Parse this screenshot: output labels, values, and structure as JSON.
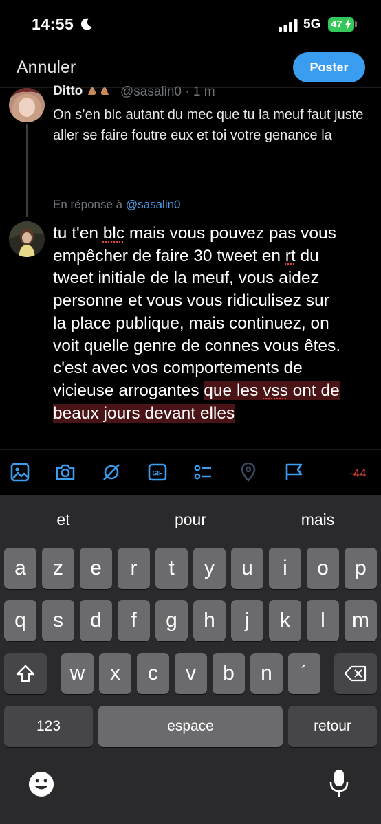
{
  "status_bar": {
    "time": "14:55",
    "network": "5G",
    "battery": "47"
  },
  "header": {
    "cancel_label": "Annuler",
    "post_label": "Poster"
  },
  "original_tweet": {
    "author": "Ditto",
    "handle": "@sasalin0 · 1 m",
    "text": "On s’en blc autant du mec que tu la meuf faut juste aller se faire foutre eux et toi votre genance la"
  },
  "reply": {
    "reply_to_prefix": "En réponse à",
    "reply_to_handle": "@sasalin0",
    "lines": {
      "l1a": "tu t'en ",
      "l1b": "blc",
      "l1c": " mais vous pouvez pas vous",
      "l2a": "empêcher de faire 30 tweet en ",
      "l2b": "rt",
      "l2c": " du",
      "l3": "tweet initiale de la meuf, vous aidez",
      "l4": "personne et vous vous ridiculisez sur",
      "l5": "la place publique, mais continuez, on",
      "l6": "voit quelle genre de connes vous êtes.",
      "l7": "c'est avec vos comportements de",
      "l8a": "vicieuse arrogantes ",
      "l8b": "que les ",
      "l8c": "vss",
      "l8d": " ont de",
      "l9": "beaux jours devant elles"
    }
  },
  "toolbar": {
    "char_count": "-44",
    "icons": [
      "image-icon",
      "camera-icon",
      "spaces-icon",
      "gif-icon",
      "poll-icon",
      "location-icon",
      "flag-icon"
    ],
    "accent": "#3b9df0"
  },
  "keyboard": {
    "suggestions": [
      "et",
      "pour",
      "mais"
    ],
    "row1": [
      "a",
      "z",
      "e",
      "r",
      "t",
      "y",
      "u",
      "i",
      "o",
      "p"
    ],
    "row2": [
      "q",
      "s",
      "d",
      "f",
      "g",
      "h",
      "j",
      "k",
      "l",
      "m"
    ],
    "row3": [
      "w",
      "x",
      "c",
      "v",
      "b",
      "n",
      "´"
    ],
    "numbers_label": "123",
    "space_label": "espace",
    "return_label": "retour"
  }
}
